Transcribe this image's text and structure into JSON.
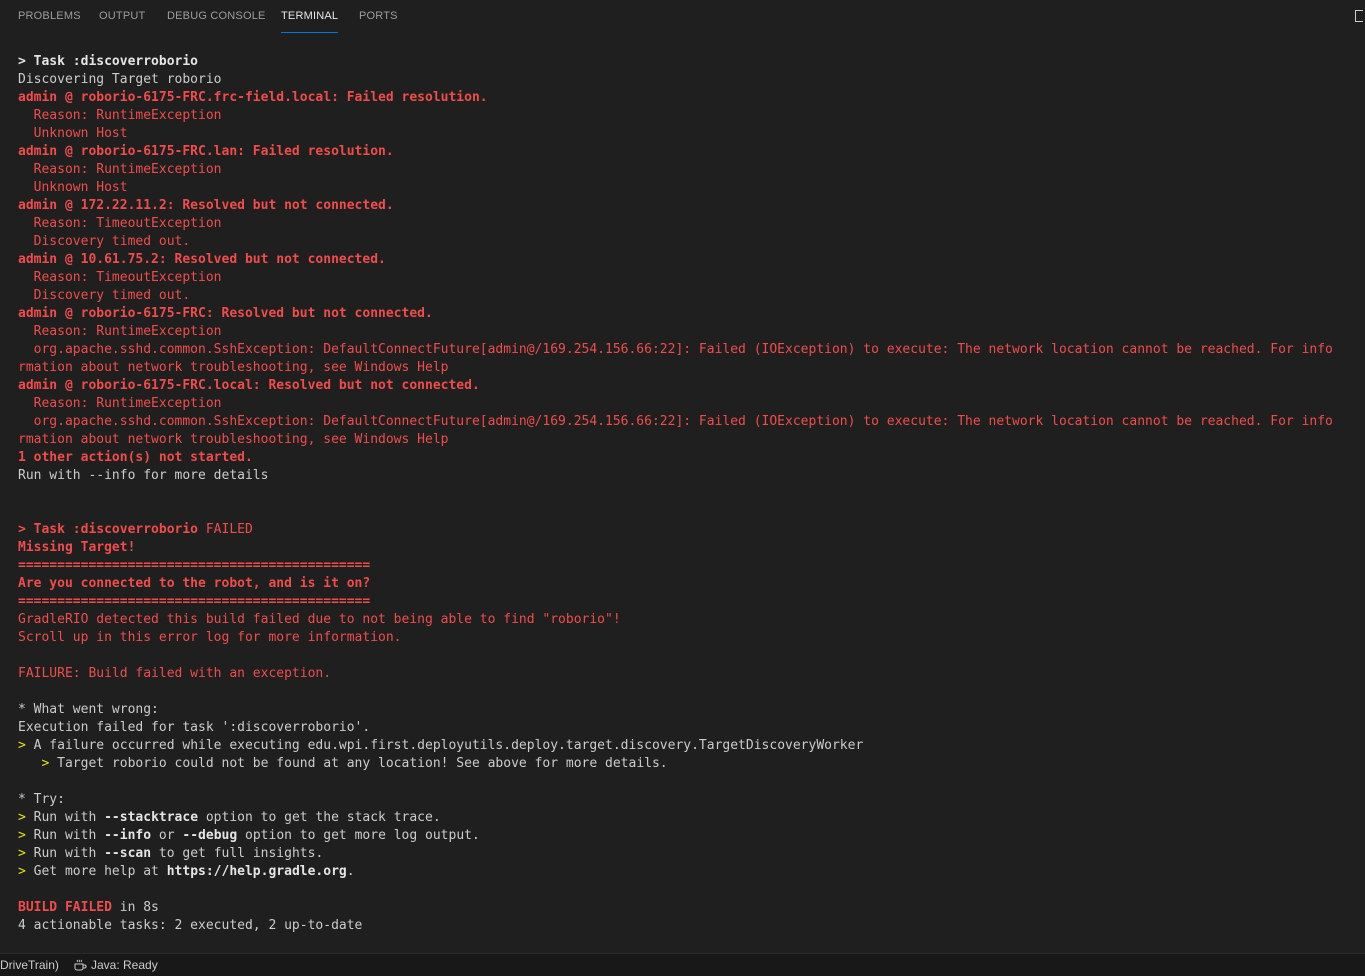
{
  "panel": {
    "tabs": [
      {
        "label": "PROBLEMS",
        "active": false
      },
      {
        "label": "OUTPUT",
        "active": false
      },
      {
        "label": "DEBUG CONSOLE",
        "active": false
      },
      {
        "label": "TERMINAL",
        "active": true
      },
      {
        "label": "PORTS",
        "active": false
      }
    ]
  },
  "terminal": {
    "lines": [
      [
        {
          "t": "> Task :discoverroborio",
          "c": "bwhite",
          "b": true
        }
      ],
      [
        {
          "t": "Discovering Target roborio",
          "c": "white"
        }
      ],
      [
        {
          "t": "admin @ roborio-6175-FRC.frc-field.local: Failed resolution.",
          "c": "red",
          "b": true
        }
      ],
      [
        {
          "t": "  Reason: RuntimeException",
          "c": "red"
        }
      ],
      [
        {
          "t": "  Unknown Host",
          "c": "red"
        }
      ],
      [
        {
          "t": "admin @ roborio-6175-FRC.lan: Failed resolution.",
          "c": "red",
          "b": true
        }
      ],
      [
        {
          "t": "  Reason: RuntimeException",
          "c": "red"
        }
      ],
      [
        {
          "t": "  Unknown Host",
          "c": "red"
        }
      ],
      [
        {
          "t": "admin @ 172.22.11.2: Resolved but not connected.",
          "c": "red",
          "b": true
        }
      ],
      [
        {
          "t": "  Reason: TimeoutException",
          "c": "red"
        }
      ],
      [
        {
          "t": "  Discovery timed out.",
          "c": "red"
        }
      ],
      [
        {
          "t": "admin @ 10.61.75.2: Resolved but not connected.",
          "c": "red",
          "b": true
        }
      ],
      [
        {
          "t": "  Reason: TimeoutException",
          "c": "red"
        }
      ],
      [
        {
          "t": "  Discovery timed out.",
          "c": "red"
        }
      ],
      [
        {
          "t": "admin @ roborio-6175-FRC: Resolved but not connected.",
          "c": "red",
          "b": true
        }
      ],
      [
        {
          "t": "  Reason: RuntimeException",
          "c": "red"
        }
      ],
      [
        {
          "t": "  org.apache.sshd.common.SshException: DefaultConnectFuture[admin@/169.254.156.66:22]: Failed (IOException) to execute: The network location cannot be reached. For info",
          "c": "red"
        }
      ],
      [
        {
          "t": "rmation about network troubleshooting, see Windows Help",
          "c": "red"
        }
      ],
      [
        {
          "t": "admin @ roborio-6175-FRC.local: Resolved but not connected.",
          "c": "red",
          "b": true
        }
      ],
      [
        {
          "t": "  Reason: RuntimeException",
          "c": "red"
        }
      ],
      [
        {
          "t": "  org.apache.sshd.common.SshException: DefaultConnectFuture[admin@/169.254.156.66:22]: Failed (IOException) to execute: The network location cannot be reached. For info",
          "c": "red"
        }
      ],
      [
        {
          "t": "rmation about network troubleshooting, see Windows Help",
          "c": "red"
        }
      ],
      [
        {
          "t": "1 other action(s) not started.",
          "c": "red",
          "b": true
        }
      ],
      [
        {
          "t": "Run with --info for more details",
          "c": "white"
        }
      ],
      [],
      [],
      [
        {
          "t": "> Task :discoverroborio ",
          "c": "red",
          "b": true
        },
        {
          "t": "FAILED",
          "c": "red"
        }
      ],
      [
        {
          "t": "Missing Target!",
          "c": "red",
          "b": true
        }
      ],
      [
        {
          "t": "=============================================",
          "c": "red",
          "b": true
        }
      ],
      [
        {
          "t": "Are you connected to the robot, and is it on?",
          "c": "red",
          "b": true
        }
      ],
      [
        {
          "t": "=============================================",
          "c": "red",
          "b": true
        }
      ],
      [
        {
          "t": "GradleRIO detected this build failed due to not being able to find \"roborio\"!",
          "c": "red"
        }
      ],
      [
        {
          "t": "Scroll up in this error log for more information.",
          "c": "red"
        }
      ],
      [],
      [
        {
          "t": "FAILURE: Build failed with an exception.",
          "c": "red"
        }
      ],
      [],
      [
        {
          "t": "* What went wrong:",
          "c": "white"
        }
      ],
      [
        {
          "t": "Execution failed for task ':discoverroborio'.",
          "c": "white"
        }
      ],
      [
        {
          "t": "> ",
          "c": "yellow"
        },
        {
          "t": "A failure occurred while executing edu.wpi.first.deployutils.deploy.target.discovery.TargetDiscoveryWorker",
          "c": "white"
        }
      ],
      [
        {
          "t": "   > ",
          "c": "yellow"
        },
        {
          "t": "Target roborio could not be found at any location! See above for more details.",
          "c": "white"
        }
      ],
      [],
      [
        {
          "t": "* Try:",
          "c": "white"
        }
      ],
      [
        {
          "t": "> ",
          "c": "yellow"
        },
        {
          "t": "Run with ",
          "c": "white"
        },
        {
          "t": "--stacktrace",
          "c": "bwhite",
          "b": true
        },
        {
          "t": " option to get the stack trace.",
          "c": "white"
        }
      ],
      [
        {
          "t": "> ",
          "c": "yellow"
        },
        {
          "t": "Run with ",
          "c": "white"
        },
        {
          "t": "--info",
          "c": "bwhite",
          "b": true
        },
        {
          "t": " or ",
          "c": "white"
        },
        {
          "t": "--debug",
          "c": "bwhite",
          "b": true
        },
        {
          "t": " option to get more log output.",
          "c": "white"
        }
      ],
      [
        {
          "t": "> ",
          "c": "yellow"
        },
        {
          "t": "Run with ",
          "c": "white"
        },
        {
          "t": "--scan",
          "c": "bwhite",
          "b": true
        },
        {
          "t": " to get full insights.",
          "c": "white"
        }
      ],
      [
        {
          "t": "> ",
          "c": "yellow"
        },
        {
          "t": "Get more help at ",
          "c": "white"
        },
        {
          "t": "https://help.gradle.org",
          "c": "bwhite",
          "b": true
        },
        {
          "t": ".",
          "c": "white"
        }
      ],
      [],
      [
        {
          "t": "BUILD FAILED",
          "c": "red",
          "b": true
        },
        {
          "t": " in 8s",
          "c": "white"
        }
      ],
      [
        {
          "t": "4 actionable tasks: 2 executed, 2 up-to-date",
          "c": "white"
        }
      ]
    ]
  },
  "statusbar": {
    "project_label": "DriveTrain)",
    "java_status": "Java: Ready"
  },
  "colors": {
    "background": "#1f1f1f",
    "error_red": "#f14c4c",
    "prompt_yellow": "#e5e510",
    "text": "#cccccc",
    "active_tab_border": "#0078d4"
  },
  "icons": {
    "java_status": "coffee-icon",
    "maximize": "maximize-panel-icon"
  }
}
